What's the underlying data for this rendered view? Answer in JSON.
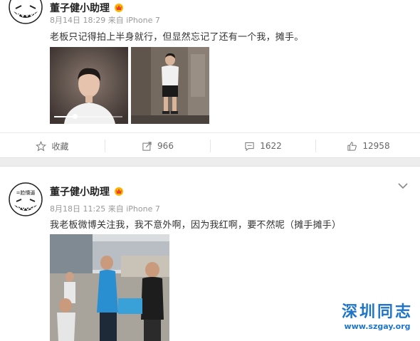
{
  "colors": {
    "text_primary": "#333333",
    "text_meta": "#999999",
    "separator": "#ededed",
    "watermark_blue": "#1e74c9"
  },
  "posts": [
    {
      "username": "董子健小助理",
      "date": "8月14日 18:29",
      "source_prefix": "来自",
      "device": "iPhone 7",
      "text": "老板只记得拍上半身就行，但显然忘记了还有一个我，摊手。",
      "avatar_text": "",
      "images": [
        {
          "icon": "video-thumbnail",
          "has_progress_bar": true
        },
        {
          "icon": "photo-thumbnail"
        }
      ],
      "actions": {
        "favorite_label": "收藏",
        "repost_count": "966",
        "comment_count": "1622",
        "like_count": "12958"
      }
    },
    {
      "username": "董子健小助理",
      "date": "8月18日 11:25",
      "source_prefix": "来自",
      "device": "iPhone 7",
      "text": "我老板微博关注我，我不意外啊，因为我红啊，要不然呢（摊手摊手）",
      "avatar_text": "=脸懵逼",
      "images": [
        {
          "icon": "photo-thumbnail"
        }
      ]
    }
  ],
  "watermark": {
    "title": "深圳同志",
    "url": "www.szgay.org"
  }
}
